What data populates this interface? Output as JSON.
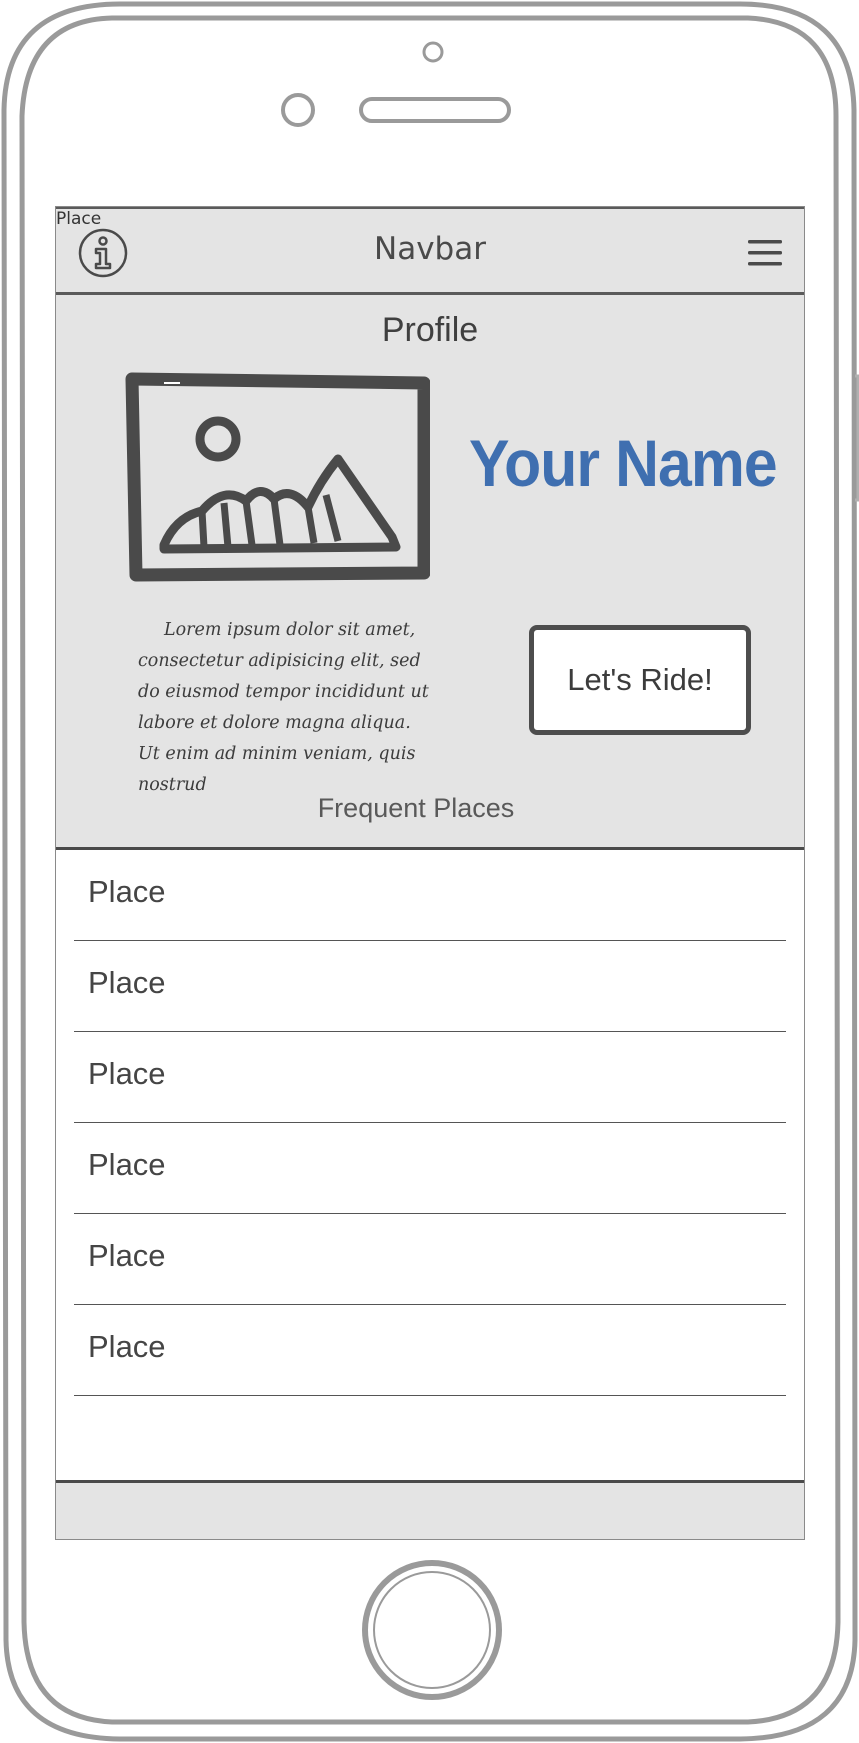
{
  "navbar": {
    "corner_label": "Place",
    "title": "Navbar",
    "info_icon": "info-icon",
    "menu_icon": "hamburger-menu-icon"
  },
  "profile": {
    "heading": "Profile",
    "image_icon": "image-placeholder-icon",
    "name": "Your Name",
    "bio": "Lorem ipsum dolor sit amet, consectetur adipisicing elit, sed do eiusmod tempor incididunt ut labore et dolore magna aliqua. Ut enim ad minim veniam, quis nostrud",
    "ride_button": "Let's Ride!",
    "frequent_heading": "Frequent Places"
  },
  "places": [
    {
      "label": "Place"
    },
    {
      "label": "Place"
    },
    {
      "label": "Place"
    },
    {
      "label": "Place"
    },
    {
      "label": "Place"
    },
    {
      "label": "Place"
    }
  ],
  "colors": {
    "name_accent": "#3f6fb0",
    "screen_background": "#e4e4e4",
    "outline": "#a0a0a0"
  }
}
